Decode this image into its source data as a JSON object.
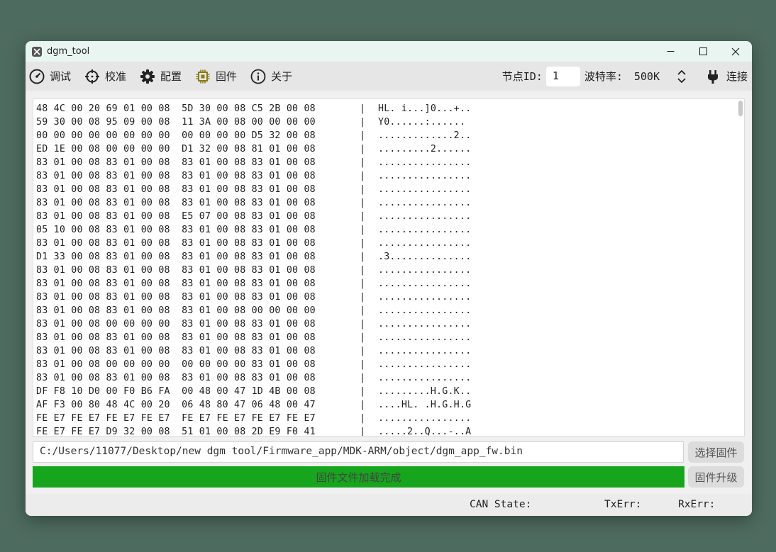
{
  "window": {
    "title": "dgm_tool"
  },
  "toolbar": {
    "items": [
      {
        "label": "调试",
        "icon": "gauge-icon"
      },
      {
        "label": "校准",
        "icon": "crosshair-icon"
      },
      {
        "label": "配置",
        "icon": "gear-icon"
      },
      {
        "label": "固件",
        "icon": "chip-icon"
      },
      {
        "label": "关于",
        "icon": "info-icon"
      }
    ],
    "node_id_label": "节点ID:",
    "node_id_value": "1",
    "baud_label": "波特率:",
    "baud_value": "500K",
    "connect_label": "连接"
  },
  "hex_dump": {
    "separator": "|",
    "lines": [
      {
        "hex": "48 4C 00 20 69 01 00 08  5D 30 00 08 C5 2B 00 08",
        "ascii": "HL. i...]0...+.."
      },
      {
        "hex": "59 30 00 08 95 09 00 08  11 3A 00 08 00 00 00 00",
        "ascii": "Y0......:......"
      },
      {
        "hex": "00 00 00 00 00 00 00 00  00 00 00 00 D5 32 00 08",
        "ascii": ".............2.."
      },
      {
        "hex": "ED 1E 00 08 00 00 00 00  D1 32 00 08 81 01 00 08",
        "ascii": ".........2......"
      },
      {
        "hex": "83 01 00 08 83 01 00 08  83 01 00 08 83 01 00 08",
        "ascii": "................"
      },
      {
        "hex": "83 01 00 08 83 01 00 08  83 01 00 08 83 01 00 08",
        "ascii": "................"
      },
      {
        "hex": "83 01 00 08 83 01 00 08  83 01 00 08 83 01 00 08",
        "ascii": "................"
      },
      {
        "hex": "83 01 00 08 83 01 00 08  83 01 00 08 83 01 00 08",
        "ascii": "................"
      },
      {
        "hex": "83 01 00 08 83 01 00 08  E5 07 00 08 83 01 00 08",
        "ascii": "................"
      },
      {
        "hex": "05 10 00 08 83 01 00 08  83 01 00 08 83 01 00 08",
        "ascii": "................"
      },
      {
        "hex": "83 01 00 08 83 01 00 08  83 01 00 08 83 01 00 08",
        "ascii": "................"
      },
      {
        "hex": "D1 33 00 08 83 01 00 08  83 01 00 08 83 01 00 08",
        "ascii": ".3.............."
      },
      {
        "hex": "83 01 00 08 83 01 00 08  83 01 00 08 83 01 00 08",
        "ascii": "................"
      },
      {
        "hex": "83 01 00 08 83 01 00 08  83 01 00 08 83 01 00 08",
        "ascii": "................"
      },
      {
        "hex": "83 01 00 08 83 01 00 08  83 01 00 08 83 01 00 08",
        "ascii": "................"
      },
      {
        "hex": "83 01 00 08 83 01 00 08  83 01 00 08 00 00 00 00",
        "ascii": "................"
      },
      {
        "hex": "83 01 00 08 00 00 00 00  83 01 00 08 83 01 00 08",
        "ascii": "................"
      },
      {
        "hex": "83 01 00 08 83 01 00 08  83 01 00 08 83 01 00 08",
        "ascii": "................"
      },
      {
        "hex": "83 01 00 08 83 01 00 08  83 01 00 08 83 01 00 08",
        "ascii": "................"
      },
      {
        "hex": "83 01 00 08 00 00 00 00  00 00 00 00 83 01 00 08",
        "ascii": "................"
      },
      {
        "hex": "83 01 00 08 83 01 00 08  83 01 00 08 83 01 00 08",
        "ascii": "................"
      },
      {
        "hex": "DF F8 10 D0 00 F0 B6 FA  00 48 00 47 1D 4B 00 08",
        "ascii": ".........H.G.K.."
      },
      {
        "hex": "AF F3 00 80 48 4C 00 20  06 48 80 47 06 48 00 47",
        "ascii": "....HL. .H.G.H.G"
      },
      {
        "hex": "FE E7 FE E7 FE E7 FE E7  FE E7 FE E7 FE E7 FE E7",
        "ascii": "................"
      },
      {
        "hex": "FE E7 FE E7 D9 32 00 08  51 01 00 08 2D E9 F0 41",
        "ascii": ".....2..Q...-..A"
      }
    ]
  },
  "firmware": {
    "path": "C:/Users/11077/Desktop/new dgm tool/Firmware_app/MDK-ARM/object/dgm_app_fw.bin",
    "select_label": "选择固件",
    "progress_text": "固件文件加载完成",
    "progress_percent": 100,
    "upgrade_label": "固件升级"
  },
  "status": {
    "can_state_label": "CAN State:",
    "txerr_label": "TxErr:",
    "rxerr_label": "RxErr:"
  },
  "colors": {
    "progress_fill": "#16a51d",
    "titlebar_bg": "#e8f5f1",
    "desktop_bg": "#4e6b5f"
  }
}
